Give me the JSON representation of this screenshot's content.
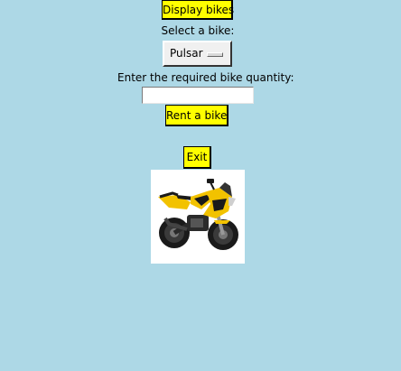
{
  "buttons": {
    "display_bikes": "Display bikes",
    "rent": "Rent a bike",
    "exit": "Exit"
  },
  "labels": {
    "select_bike": "Select a bike:",
    "quantity": "Enter the required bike quantity:"
  },
  "bike_select": {
    "selected": "Pulsar"
  },
  "quantity_input": {
    "value": ""
  },
  "image": {
    "icon": "motorcycle-image",
    "body_color": "#f2c200",
    "frame_color": "#1a1a1a"
  },
  "colors": {
    "background": "#add8e6",
    "button": "#ffff00"
  }
}
